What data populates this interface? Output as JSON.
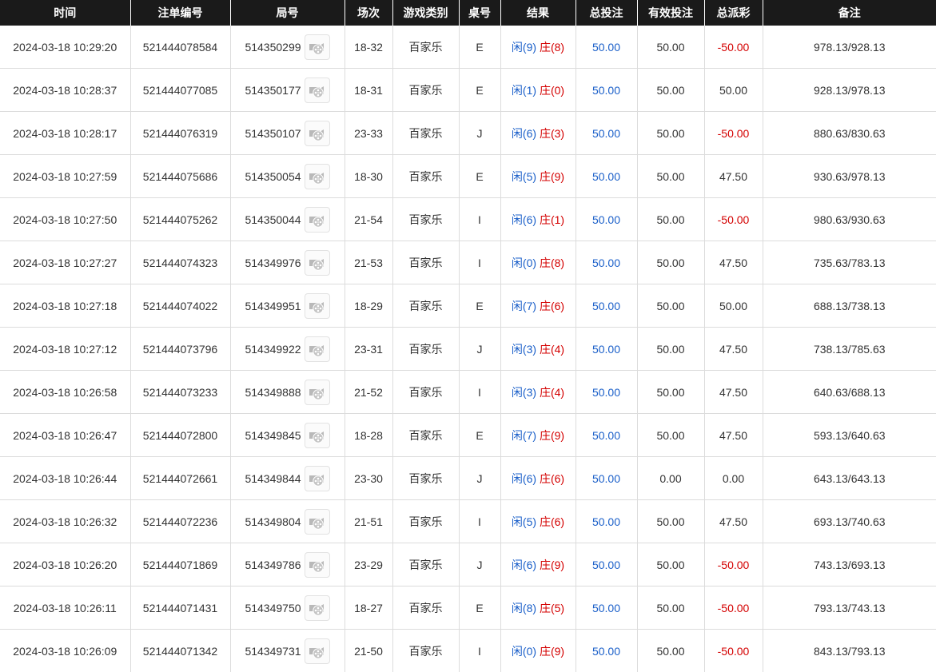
{
  "headers": [
    "时间",
    "注单编号",
    "局号",
    "场次",
    "游戏类别",
    "桌号",
    "结果",
    "总投注",
    "有效投注",
    "总派彩",
    "备注"
  ],
  "labels": {
    "player": "闲",
    "banker": "庄"
  },
  "colors": {
    "header_bg": "#1a1a1a",
    "player": "#1a5fc9",
    "banker": "#d40000",
    "total_bet": "#1a5fc9",
    "negative_payout": "#d40000"
  },
  "video_icon": "film-reel-icon",
  "rows": [
    {
      "time": "2024-03-18 10:29:20",
      "order_no": "521444078584",
      "round_no": "514350299",
      "session": "18-32",
      "game": "百家乐",
      "table": "E",
      "player": "(9)",
      "banker": "(8)",
      "total_bet": "50.00",
      "valid_bet": "50.00",
      "payout": "-50.00",
      "remark": "978.13/928.13"
    },
    {
      "time": "2024-03-18 10:28:37",
      "order_no": "521444077085",
      "round_no": "514350177",
      "session": "18-31",
      "game": "百家乐",
      "table": "E",
      "player": "(1)",
      "banker": "(0)",
      "total_bet": "50.00",
      "valid_bet": "50.00",
      "payout": "50.00",
      "remark": "928.13/978.13"
    },
    {
      "time": "2024-03-18 10:28:17",
      "order_no": "521444076319",
      "round_no": "514350107",
      "session": "23-33",
      "game": "百家乐",
      "table": "J",
      "player": "(6)",
      "banker": "(3)",
      "total_bet": "50.00",
      "valid_bet": "50.00",
      "payout": "-50.00",
      "remark": "880.63/830.63"
    },
    {
      "time": "2024-03-18 10:27:59",
      "order_no": "521444075686",
      "round_no": "514350054",
      "session": "18-30",
      "game": "百家乐",
      "table": "E",
      "player": "(5)",
      "banker": "(9)",
      "total_bet": "50.00",
      "valid_bet": "50.00",
      "payout": "47.50",
      "remark": "930.63/978.13"
    },
    {
      "time": "2024-03-18 10:27:50",
      "order_no": "521444075262",
      "round_no": "514350044",
      "session": "21-54",
      "game": "百家乐",
      "table": "I",
      "player": "(6)",
      "banker": "(1)",
      "total_bet": "50.00",
      "valid_bet": "50.00",
      "payout": "-50.00",
      "remark": "980.63/930.63"
    },
    {
      "time": "2024-03-18 10:27:27",
      "order_no": "521444074323",
      "round_no": "514349976",
      "session": "21-53",
      "game": "百家乐",
      "table": "I",
      "player": "(0)",
      "banker": "(8)",
      "total_bet": "50.00",
      "valid_bet": "50.00",
      "payout": "47.50",
      "remark": "735.63/783.13"
    },
    {
      "time": "2024-03-18 10:27:18",
      "order_no": "521444074022",
      "round_no": "514349951",
      "session": "18-29",
      "game": "百家乐",
      "table": "E",
      "player": "(7)",
      "banker": "(6)",
      "total_bet": "50.00",
      "valid_bet": "50.00",
      "payout": "50.00",
      "remark": "688.13/738.13"
    },
    {
      "time": "2024-03-18 10:27:12",
      "order_no": "521444073796",
      "round_no": "514349922",
      "session": "23-31",
      "game": "百家乐",
      "table": "J",
      "player": "(3)",
      "banker": "(4)",
      "total_bet": "50.00",
      "valid_bet": "50.00",
      "payout": "47.50",
      "remark": "738.13/785.63"
    },
    {
      "time": "2024-03-18 10:26:58",
      "order_no": "521444073233",
      "round_no": "514349888",
      "session": "21-52",
      "game": "百家乐",
      "table": "I",
      "player": "(3)",
      "banker": "(4)",
      "total_bet": "50.00",
      "valid_bet": "50.00",
      "payout": "47.50",
      "remark": "640.63/688.13"
    },
    {
      "time": "2024-03-18 10:26:47",
      "order_no": "521444072800",
      "round_no": "514349845",
      "session": "18-28",
      "game": "百家乐",
      "table": "E",
      "player": "(7)",
      "banker": "(9)",
      "total_bet": "50.00",
      "valid_bet": "50.00",
      "payout": "47.50",
      "remark": "593.13/640.63"
    },
    {
      "time": "2024-03-18 10:26:44",
      "order_no": "521444072661",
      "round_no": "514349844",
      "session": "23-30",
      "game": "百家乐",
      "table": "J",
      "player": "(6)",
      "banker": "(6)",
      "total_bet": "50.00",
      "valid_bet": "0.00",
      "payout": "0.00",
      "remark": "643.13/643.13"
    },
    {
      "time": "2024-03-18 10:26:32",
      "order_no": "521444072236",
      "round_no": "514349804",
      "session": "21-51",
      "game": "百家乐",
      "table": "I",
      "player": "(5)",
      "banker": "(6)",
      "total_bet": "50.00",
      "valid_bet": "50.00",
      "payout": "47.50",
      "remark": "693.13/740.63"
    },
    {
      "time": "2024-03-18 10:26:20",
      "order_no": "521444071869",
      "round_no": "514349786",
      "session": "23-29",
      "game": "百家乐",
      "table": "J",
      "player": "(6)",
      "banker": "(9)",
      "total_bet": "50.00",
      "valid_bet": "50.00",
      "payout": "-50.00",
      "remark": "743.13/693.13"
    },
    {
      "time": "2024-03-18 10:26:11",
      "order_no": "521444071431",
      "round_no": "514349750",
      "session": "18-27",
      "game": "百家乐",
      "table": "E",
      "player": "(8)",
      "banker": "(5)",
      "total_bet": "50.00",
      "valid_bet": "50.00",
      "payout": "-50.00",
      "remark": "793.13/743.13"
    },
    {
      "time": "2024-03-18 10:26:09",
      "order_no": "521444071342",
      "round_no": "514349731",
      "session": "21-50",
      "game": "百家乐",
      "table": "I",
      "player": "(0)",
      "banker": "(9)",
      "total_bet": "50.00",
      "valid_bet": "50.00",
      "payout": "-50.00",
      "remark": "843.13/793.13"
    }
  ]
}
